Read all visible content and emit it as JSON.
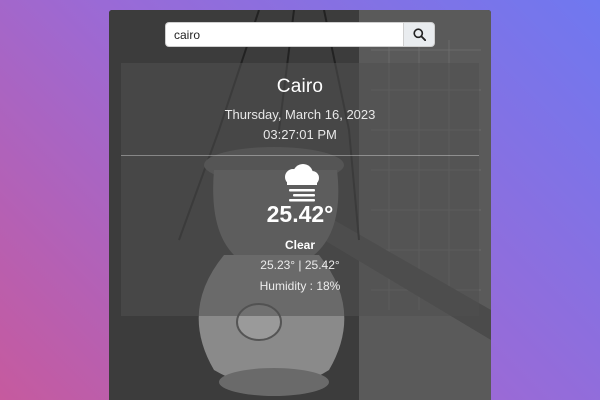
{
  "search": {
    "value": "cairo",
    "placeholder": ""
  },
  "weather": {
    "city": "Cairo",
    "date": "Thursday, March 16, 2023",
    "time": "03:27:01 PM",
    "temperature": "25.42°",
    "condition": "Clear",
    "min_max": "25.23° | 25.42°",
    "humidity": "Humidity : 18%",
    "icon": "mist-cloud-icon"
  },
  "colors": {
    "gradient_start": "#c65a9e",
    "gradient_end": "#6f78f0",
    "panel": "rgba(80,80,80,0.55)"
  }
}
